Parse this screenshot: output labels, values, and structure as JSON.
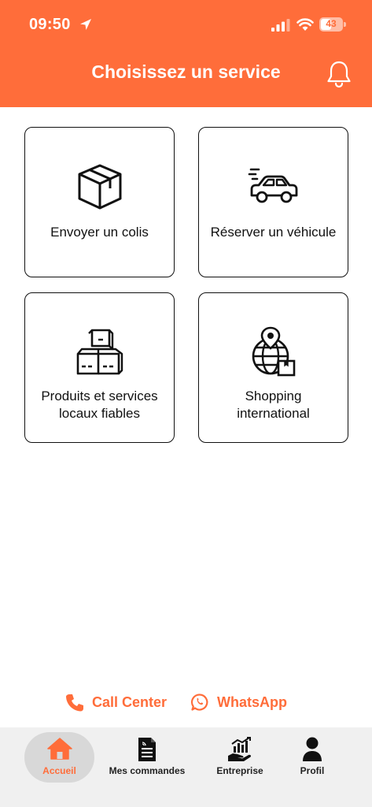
{
  "status_bar": {
    "time": "09:50",
    "battery": "43"
  },
  "header": {
    "title": "Choisissez un service"
  },
  "services": [
    {
      "label": "Envoyer un colis"
    },
    {
      "label": "Réserver un véhicule"
    },
    {
      "label_line1": "Produits et services",
      "label_line2": "locaux fiables"
    },
    {
      "label_line1": "Shopping",
      "label_line2": "international"
    }
  ],
  "support": {
    "call_center": "Call Center",
    "whatsapp": "WhatsApp"
  },
  "tabs": [
    {
      "label": "Accueil",
      "active": true
    },
    {
      "label": "Mes commandes"
    },
    {
      "label": "Entreprise"
    },
    {
      "label": "Profil"
    }
  ],
  "colors": {
    "accent": "#ff6d3a",
    "tabbar_bg": "#f0f0f0",
    "active_pill": "#d8d8d8"
  },
  "icons": [
    "location-arrow-icon",
    "signal-icon",
    "wifi-icon",
    "battery-icon",
    "bell-icon",
    "package-box-icon",
    "car-icon",
    "stacked-boxes-icon",
    "globe-shopping-icon",
    "phone-icon",
    "whatsapp-icon",
    "home-icon",
    "document-icon",
    "business-chart-icon",
    "person-icon"
  ]
}
